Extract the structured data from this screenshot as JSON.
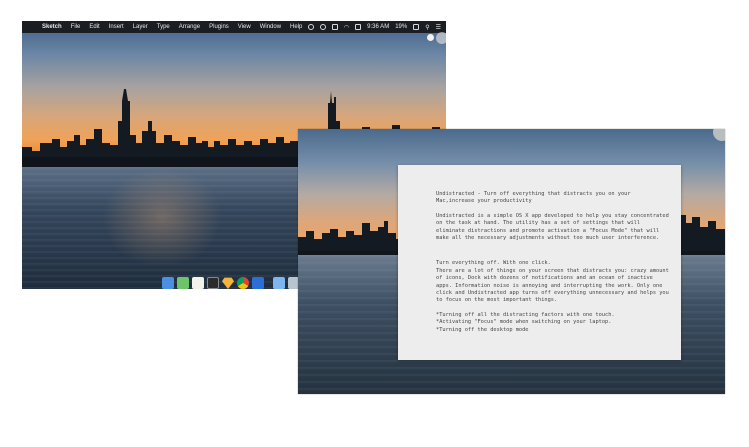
{
  "menubar": {
    "apple_symbol": "",
    "app_name": "Sketch",
    "items": [
      "File",
      "Edit",
      "Insert",
      "Layer",
      "Type",
      "Arrange",
      "Plugins",
      "View",
      "Window",
      "Help"
    ],
    "time": "9:36 AM",
    "battery": "19%"
  },
  "dock": {
    "icons": [
      {
        "name": "finder",
        "color": "#4a8fe0"
      },
      {
        "name": "checklist-app",
        "color": "#6fc36a"
      },
      {
        "name": "notes-app",
        "color": "#f3f3ea"
      },
      {
        "name": "terminal",
        "color": "#2b2b2b"
      },
      {
        "name": "sketch",
        "color": "#f6b23a"
      },
      {
        "name": "chrome",
        "color": "#db4437"
      },
      {
        "name": "word",
        "color": "#2b6fd6"
      },
      {
        "name": "folder",
        "color": "#7eb6f0"
      },
      {
        "name": "trash",
        "color": "#b8c4cf"
      }
    ]
  },
  "article": {
    "paragraphs": [
      "Undistracted - Turn off everything that distracts you on your Mac,increase your productivity",
      "Undistracted is a simple OS X app developed to help you stay concentrated on the task at hand. The utility has a set of settings that will eliminate distractions and promote activation a \"Focus Mode\" that will make all the necessary adjustments without too much user interference.",
      "Turn everything off. With one click.\nThere are a lot of things on your screen that distracts you: crazy amount of icons, Dock with dozens of notifications and an ocean of inactive apps. Information noise is annoying and interrupting the work. Only one click and Undistracted app turns off everything unnecessary and helps you to focus on the most important things.",
      "*Turning off all the distracting factors with one touch.\n*Activating \"Focus\" mode when switching on your laptop.\n*Turning off the desktop mode"
    ]
  }
}
